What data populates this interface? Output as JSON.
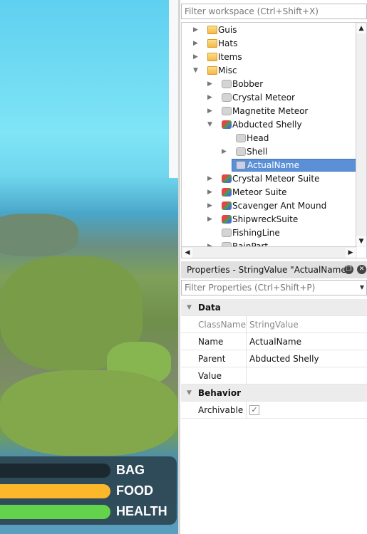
{
  "hud": {
    "bars": [
      {
        "label": "BAG",
        "color": "#1b2830",
        "fill": 1.0
      },
      {
        "label": "FOOD",
        "color": "#fdb72b",
        "fill": 1.0
      },
      {
        "label": "HEALTH",
        "color": "#63d34b",
        "fill": 1.0
      }
    ]
  },
  "explorer": {
    "filter_placeholder": "Filter workspace (Ctrl+Shift+X)",
    "items": [
      {
        "label": "Guis",
        "icon": "folder-icon",
        "level": 1,
        "arrow": "collapsed"
      },
      {
        "label": "Hats",
        "icon": "folder-icon",
        "level": 1,
        "arrow": "collapsed"
      },
      {
        "label": "Items",
        "icon": "folder-icon",
        "level": 1,
        "arrow": "collapsed"
      },
      {
        "label": "Misc",
        "icon": "folder-icon",
        "level": 1,
        "arrow": "expanded"
      },
      {
        "label": "Bobber",
        "icon": "part-icon",
        "level": 2,
        "arrow": "collapsed"
      },
      {
        "label": "Crystal Meteor",
        "icon": "part-icon",
        "level": 2,
        "arrow": "collapsed"
      },
      {
        "label": "Magnetite Meteor",
        "icon": "part-icon",
        "level": 2,
        "arrow": "collapsed"
      },
      {
        "label": "Abducted Shelly",
        "icon": "model-icon",
        "level": 2,
        "arrow": "expanded"
      },
      {
        "label": "Head",
        "icon": "part-icon",
        "level": 3,
        "arrow": "none"
      },
      {
        "label": "Shell",
        "icon": "part-icon",
        "level": 3,
        "arrow": "collapsed"
      },
      {
        "label": "ActualName",
        "icon": "string-value-icon",
        "level": 3,
        "arrow": "none",
        "selected": true
      },
      {
        "label": "Crystal Meteor Suite",
        "icon": "model-icon",
        "level": 2,
        "arrow": "collapsed"
      },
      {
        "label": "Meteor Suite",
        "icon": "model-icon",
        "level": 2,
        "arrow": "collapsed"
      },
      {
        "label": "Scavenger Ant Mound",
        "icon": "model-icon",
        "level": 2,
        "arrow": "collapsed"
      },
      {
        "label": "ShipwreckSuite",
        "icon": "model-icon",
        "level": 2,
        "arrow": "collapsed"
      },
      {
        "label": "FishingLine",
        "icon": "part-icon",
        "level": 2,
        "arrow": "none"
      },
      {
        "label": "RainPart",
        "icon": "part-icon",
        "level": 2,
        "arrow": "collapsed"
      }
    ]
  },
  "properties": {
    "title": "Properties - StringValue \"ActualName\"",
    "filter_placeholder": "Filter Properties (Ctrl+Shift+P)",
    "rows": [
      {
        "type": "category",
        "label": "Data"
      },
      {
        "type": "prop",
        "name": "ClassName",
        "value": "StringValue",
        "readonly": true
      },
      {
        "type": "prop",
        "name": "Name",
        "value": "ActualName"
      },
      {
        "type": "prop",
        "name": "Parent",
        "value": "Abducted Shelly"
      },
      {
        "type": "prop",
        "name": "Value",
        "value": ""
      },
      {
        "type": "category",
        "label": "Behavior"
      },
      {
        "type": "check",
        "name": "Archivable",
        "checked": true
      }
    ]
  }
}
